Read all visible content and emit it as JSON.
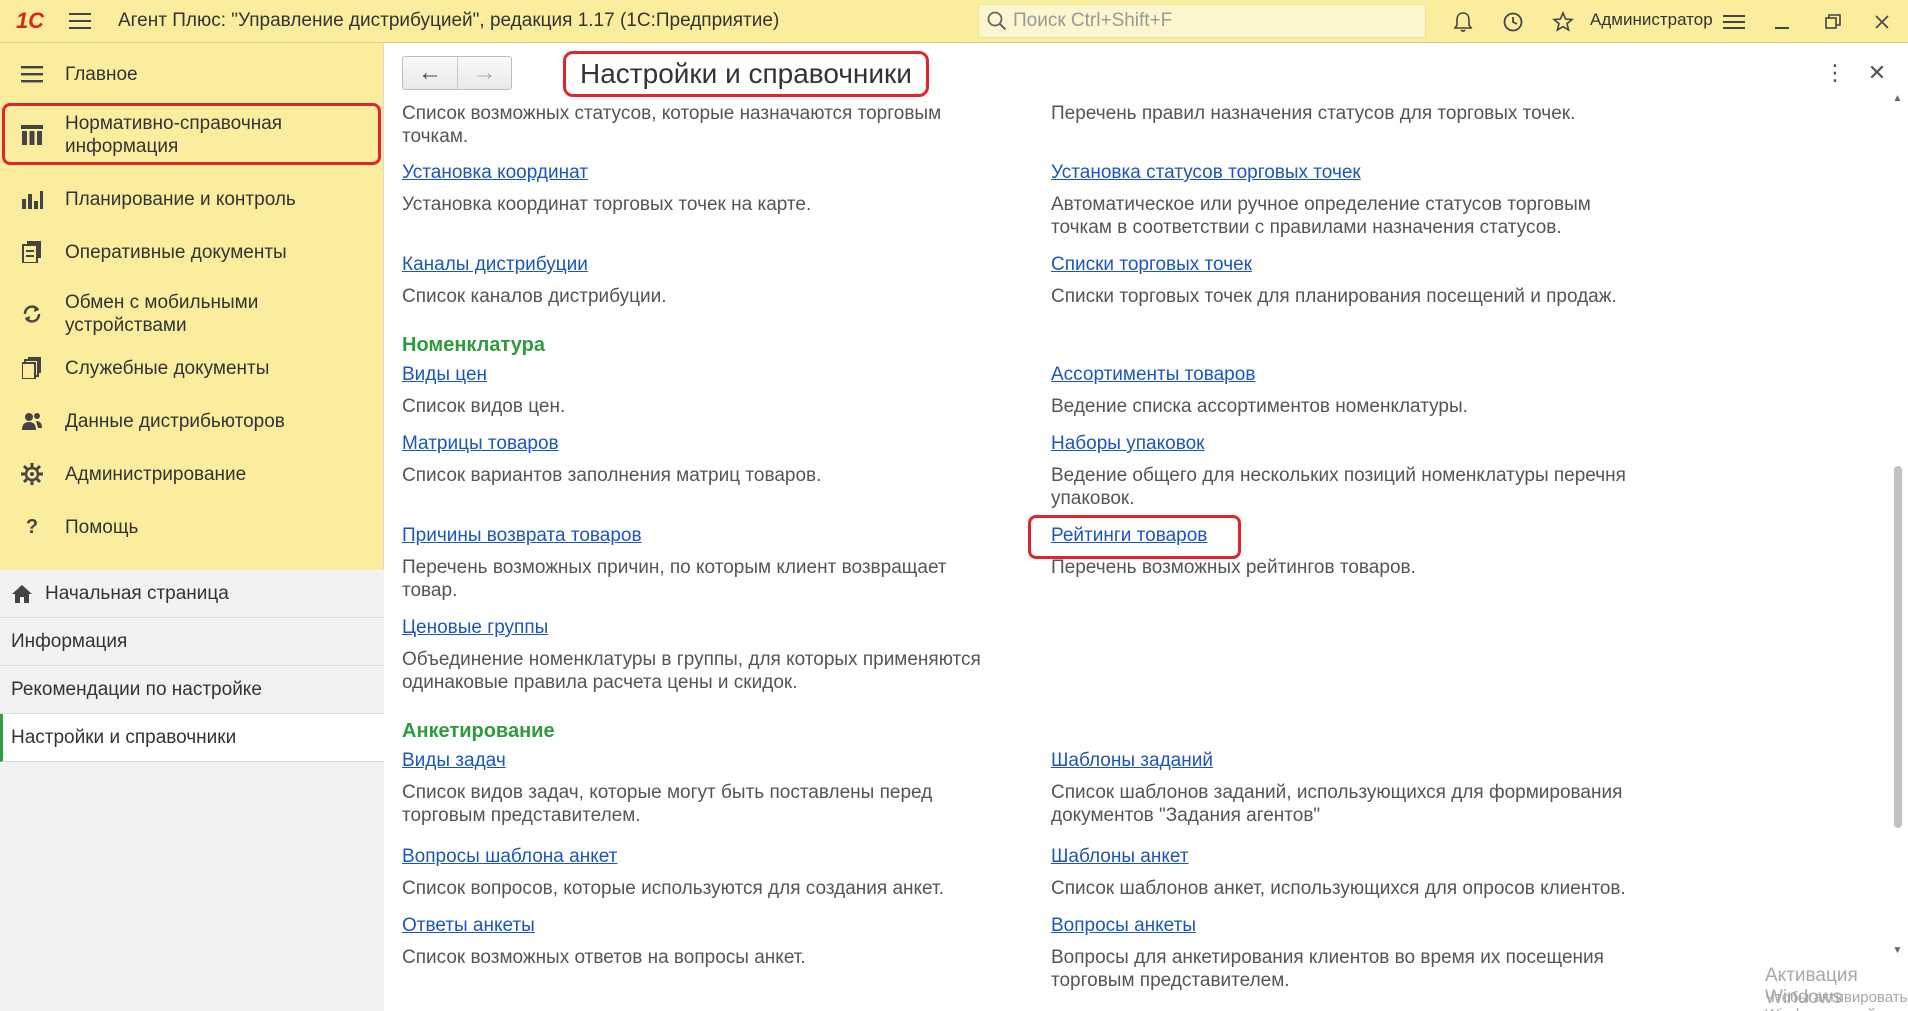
{
  "app": {
    "logo": "1С",
    "title": "Агент Плюс: \"Управление дистрибуцией\", редакция 1.17  (1С:Предприятие)",
    "search_placeholder": "Поиск Ctrl+Shift+F",
    "user": "Администратор"
  },
  "sidebar": {
    "items": [
      {
        "label": "Главное",
        "icon": "menu-lines-icon"
      },
      {
        "label": "Нормативно-справочная информация",
        "icon": "columns-icon"
      },
      {
        "label": "Планирование и контроль",
        "icon": "bar-chart-icon"
      },
      {
        "label": "Оперативные документы",
        "icon": "documents-icon"
      },
      {
        "label": "Обмен с мобильными устройствами",
        "icon": "sync-icon"
      },
      {
        "label": "Служебные документы",
        "icon": "doc-stack-icon"
      },
      {
        "label": "Данные дистрибьюторов",
        "icon": "users-icon"
      },
      {
        "label": "Администрирование",
        "icon": "gear-icon"
      },
      {
        "label": "Помощь",
        "icon": "question-icon"
      }
    ],
    "bottom": [
      {
        "label": "Начальная страница"
      },
      {
        "label": "Информация"
      },
      {
        "label": "Рекомендации по настройке"
      },
      {
        "label": "Настройки и справочники"
      }
    ]
  },
  "main": {
    "title": "Настройки и справочники",
    "top_left_desc": "Список возможных статусов, которые назначаются торговым точкам.",
    "top_right_desc": "Перечень правил назначения статусов для торговых точек.",
    "group1": {
      "left": [
        {
          "link": "Установка координат",
          "desc": "Установка координат торговых точек на карте."
        },
        {
          "link": "Каналы дистрибуции",
          "desc": "Список каналов дистрибуции."
        }
      ],
      "right": [
        {
          "link": "Установка статусов торговых точек",
          "desc": "Автоматическое или ручное определение статусов торговым точкам в соответствии с правилами назначения статусов."
        },
        {
          "link": "Списки торговых точек",
          "desc": "Списки торговых точек для планирования посещений и продаж."
        }
      ]
    },
    "nomenclature": {
      "title": "Номенклатура",
      "left": [
        {
          "link": "Виды цен",
          "desc": "Список видов цен."
        },
        {
          "link": "Матрицы товаров",
          "desc": "Список вариантов заполнения матриц товаров."
        },
        {
          "link": "Причины возврата товаров",
          "desc": "Перечень возможных причин, по которым клиент возвращает товар."
        },
        {
          "link": "Ценовые группы",
          "desc": "Объединение номенклатуры в группы, для которых применяются одинаковые правила расчета цены и скидок."
        }
      ],
      "right": [
        {
          "link": "Ассортименты товаров",
          "desc": "Ведение списка ассортиментов номенклатуры."
        },
        {
          "link": "Наборы упаковок",
          "desc": "Ведение общего для нескольких позиций номенклатуры перечня упаковок."
        },
        {
          "link": "Рейтинги товаров",
          "desc": "Перечень возможных рейтингов товаров."
        }
      ]
    },
    "survey": {
      "title": "Анкетирование",
      "left": [
        {
          "link": "Виды задач",
          "desc": "Список видов задач, которые могут быть поставлены перед торговым представителем."
        },
        {
          "link": "Вопросы шаблона анкет",
          "desc": "Список вопросов, которые используются для создания анкет."
        },
        {
          "link": "Ответы анкеты",
          "desc": "Список возможных ответов на вопросы анкет."
        }
      ],
      "right": [
        {
          "link": "Шаблоны заданий",
          "desc": "Список шаблонов заданий, использующихся для формирования документов \"Задания агентов\""
        },
        {
          "link": "Шаблоны анкет",
          "desc": "Список шаблонов анкет, использующихся для опросов клиентов."
        },
        {
          "link": "Вопросы анкеты",
          "desc": "Вопросы для анкетирования клиентов во время их посещения торговым представителем."
        }
      ]
    }
  },
  "watermark": {
    "line1": "Активация Windows",
    "line2": "Чтобы активировать Windows, перейдите в раздел \"Параметры\"."
  }
}
